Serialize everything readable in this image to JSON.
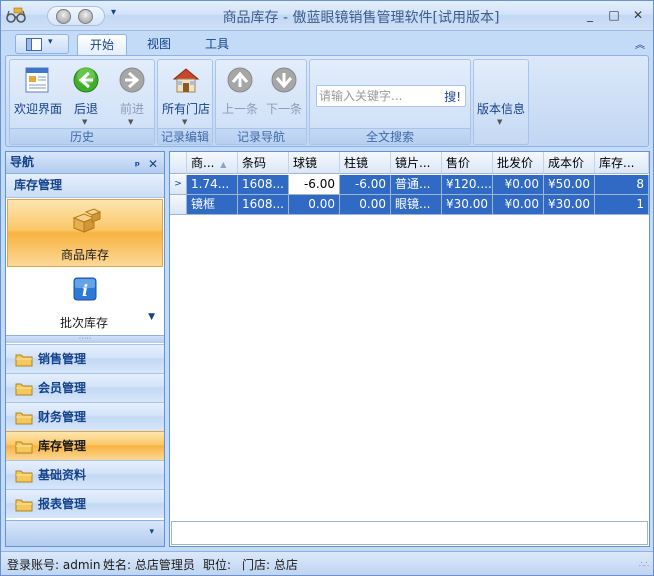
{
  "window": {
    "title": "商品库存 - 傲蓝眼镜销售管理软件[试用版本]",
    "min_label": "_",
    "max_label": "□",
    "close_label": "✕"
  },
  "qat": {
    "more_label": "▾"
  },
  "tabs": [
    {
      "label": "开始",
      "active": true
    },
    {
      "label": "视图",
      "active": false
    },
    {
      "label": "工具",
      "active": false
    }
  ],
  "ribbon": {
    "collapse_label": "︽",
    "groups": {
      "history": {
        "label": "历史",
        "buttons": [
          {
            "label": "欢迎界面",
            "icon": "welcome-icon"
          },
          {
            "label": "后退",
            "icon": "back-arrow-icon"
          },
          {
            "label": "前进",
            "icon": "forward-arrow-icon",
            "disabled": true
          }
        ]
      },
      "record_edit": {
        "label": "记录编辑",
        "buttons": [
          {
            "label": "所有门店",
            "icon": "store-icon"
          }
        ]
      },
      "record_nav": {
        "label": "记录导航",
        "buttons": [
          {
            "label": "上一条",
            "icon": "up-arrow-icon",
            "disabled": true
          },
          {
            "label": "下一条",
            "icon": "down-arrow-icon",
            "disabled": true
          }
        ]
      },
      "search": {
        "label": "全文搜索",
        "placeholder": "请输入关键字...",
        "button_label": "搜!"
      }
    },
    "version_button": "版本信息"
  },
  "nav": {
    "title": "导航",
    "pin_label": "ᵖ",
    "close_label": "✕",
    "section_title": "库存管理",
    "large_items": [
      {
        "label": "商品库存",
        "icon": "boxes-icon",
        "active": true
      },
      {
        "label": "批次库存",
        "icon": "info-icon",
        "active": false
      }
    ],
    "splitter_label": "·····",
    "categories": [
      {
        "label": "销售管理",
        "active": false
      },
      {
        "label": "会员管理",
        "active": false
      },
      {
        "label": "财务管理",
        "active": false
      },
      {
        "label": "库存管理",
        "active": true
      },
      {
        "label": "基础资料",
        "active": false
      },
      {
        "label": "报表管理",
        "active": false
      }
    ],
    "footer_chevron": "▾"
  },
  "grid": {
    "columns": [
      "商...",
      "条码",
      "球镜",
      "柱镜",
      "镜片...",
      "售价",
      "批发价",
      "成本价",
      "库存..."
    ],
    "sort_indicator": "▲",
    "rows": [
      {
        "indicator": ">",
        "cells": [
          "1.74...",
          "1608...",
          "-6.00",
          "-6.00",
          "普通...",
          "¥120....",
          "¥0.00",
          "¥50.00",
          "8"
        ]
      },
      {
        "indicator": "",
        "cells": [
          "镜框",
          "1608...",
          "0.00",
          "0.00",
          "眼镜...",
          "¥30.00",
          "¥0.00",
          "¥30.00",
          "1"
        ]
      }
    ]
  },
  "status": {
    "account": "登录账号: admin",
    "name": "姓名: 总店管理员",
    "position": "职位:",
    "store": "门店: 总店",
    "grip": "∴∴"
  },
  "colors": {
    "accent": "#15428b",
    "selection": "#316ac5",
    "active_orange": "#f8b342"
  }
}
